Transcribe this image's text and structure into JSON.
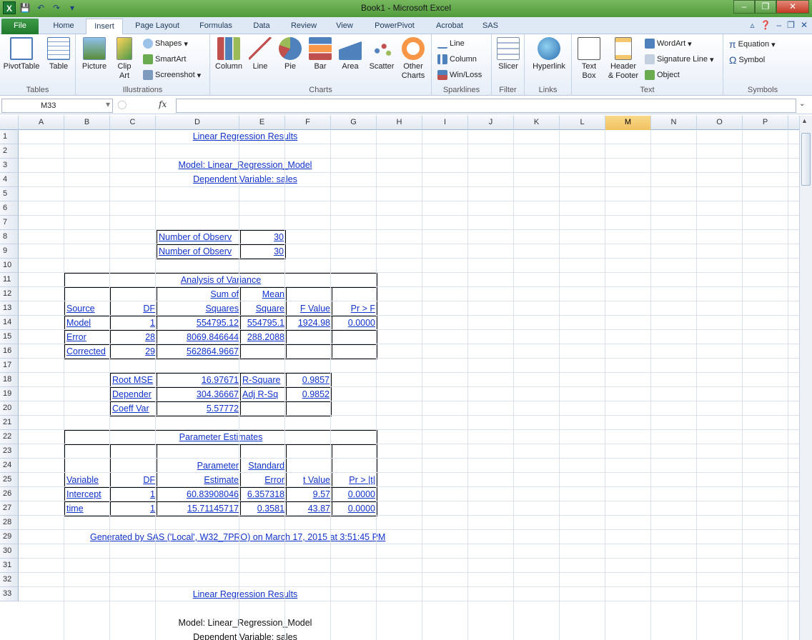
{
  "window": {
    "title": "Book1 - Microsoft Excel",
    "minimize_label": "–",
    "restore_label": "❐",
    "close_label": "✕"
  },
  "qat": {
    "logo": "X",
    "save": "💾",
    "undo": "↶",
    "redo": "↷",
    "customize": "▾"
  },
  "tabs": [
    "File",
    "Home",
    "Insert",
    "Page Layout",
    "Formulas",
    "Data",
    "Review",
    "View",
    "PowerPivot",
    "Acrobat",
    "SAS"
  ],
  "active_tab": "Insert",
  "ribbon": {
    "groups": [
      {
        "label": "Tables"
      },
      {
        "label": "Illustrations"
      },
      {
        "label": "Charts"
      },
      {
        "label": "Sparklines"
      },
      {
        "label": "Filter"
      },
      {
        "label": "Links"
      },
      {
        "label": "Text"
      },
      {
        "label": "Symbols"
      }
    ],
    "buttons": {
      "pivottable": "PivotTable",
      "table": "Table",
      "picture": "Picture",
      "clipart_1": "Clip",
      "clipart_2": "Art",
      "shapes": "Shapes",
      "smartart": "SmartArt",
      "screenshot": "Screenshot",
      "column": "Column",
      "line": "Line",
      "pie": "Pie",
      "bar": "Bar",
      "area": "Area",
      "scatter": "Scatter",
      "other_1": "Other",
      "other_2": "Charts",
      "spark_line": "Line",
      "spark_column": "Column",
      "spark_winloss": "Win/Loss",
      "slicer": "Slicer",
      "hyperlink": "Hyperlink",
      "textbox_1": "Text",
      "textbox_2": "Box",
      "header_1": "Header",
      "header_2": "& Footer",
      "wordart": "WordArt",
      "signature": "Signature Line",
      "object": "Object",
      "equation": "Equation",
      "symbol": "Symbol"
    }
  },
  "formula_bar": {
    "name_box": "M33",
    "fx": "fx",
    "value": ""
  },
  "columns": [
    "A",
    "B",
    "C",
    "D",
    "E",
    "F",
    "G",
    "H",
    "I",
    "J",
    "K",
    "L",
    "M",
    "N",
    "O",
    "P"
  ],
  "rows": [
    "1",
    "2",
    "3",
    "4",
    "5",
    "6",
    "7",
    "8",
    "9",
    "10",
    "11",
    "12",
    "13",
    "14",
    "15",
    "16",
    "17",
    "18",
    "19",
    "20",
    "21",
    "22",
    "23",
    "24",
    "25",
    "26",
    "27",
    "28",
    "29",
    "30",
    "31",
    "32",
    "33"
  ],
  "sheet": {
    "title1": "Linear Regression Results",
    "model1": "Model: Linear_Regression_Model",
    "depvar1": "Dependent Variable: sales",
    "nobs": [
      {
        "label": "Number of Observ",
        "value": "30"
      },
      {
        "label": "Number of Observ",
        "value": "30"
      }
    ],
    "anova": {
      "title": "Analysis of Variance",
      "h_source": "Source",
      "h_df": "DF",
      "h_ss_1": "Sum of",
      "h_ss_2": "Squares",
      "h_ms_1": "Mean",
      "h_ms_2": "Square",
      "h_f": "F Value",
      "h_p": "Pr > F",
      "rows": [
        {
          "source": "Model",
          "df": "1",
          "ss": "554795.12",
          "ms": "554795.1",
          "f": "1924.98",
          "p": "0.0000"
        },
        {
          "source": "Error",
          "df": "28",
          "ss": "8069.846644",
          "ms": "288.2088",
          "f": "",
          "p": ""
        },
        {
          "source": "Corrected",
          "df": "29",
          "ss": "562864.9667",
          "ms": "",
          "f": "",
          "p": ""
        }
      ]
    },
    "fit": [
      {
        "l1": "Root MSE",
        "v1": "16.97671",
        "l2": "R-Square",
        "v2": "0.9857"
      },
      {
        "l1": "Depender",
        "v1": "304.36667",
        "l2": "Adj R-Sq",
        "v2": "0.9852"
      },
      {
        "l1": "Coeff Var",
        "v1": "5.57772",
        "l2": "",
        "v2": ""
      }
    ],
    "params": {
      "title": "Parameter Estimates",
      "h_var": "Variable",
      "h_df": "DF",
      "h_est_1": "Parameter",
      "h_est_2": "Estimate",
      "h_se_1": "Standard",
      "h_se_2": "Error",
      "h_t": "t Value",
      "h_p": "Pr > |t|",
      "rows": [
        {
          "var": "Intercept",
          "df": "1",
          "est": "60.83908046",
          "se": "6.357318",
          "t": "9.57",
          "p": "0.0000"
        },
        {
          "var": "time",
          "df": "1",
          "est": "15.71145717",
          "se": "0.3581",
          "t": "43.87",
          "p": "0.0000"
        }
      ]
    },
    "generated": "Generated by SAS ('Local', W32_7PRO) on March 17, 2015 at 3:51:45 PM",
    "title2": "Linear Regression Results",
    "model2": "Model: Linear_Regression_Model",
    "depvar2": "Dependent Variable: sales"
  }
}
